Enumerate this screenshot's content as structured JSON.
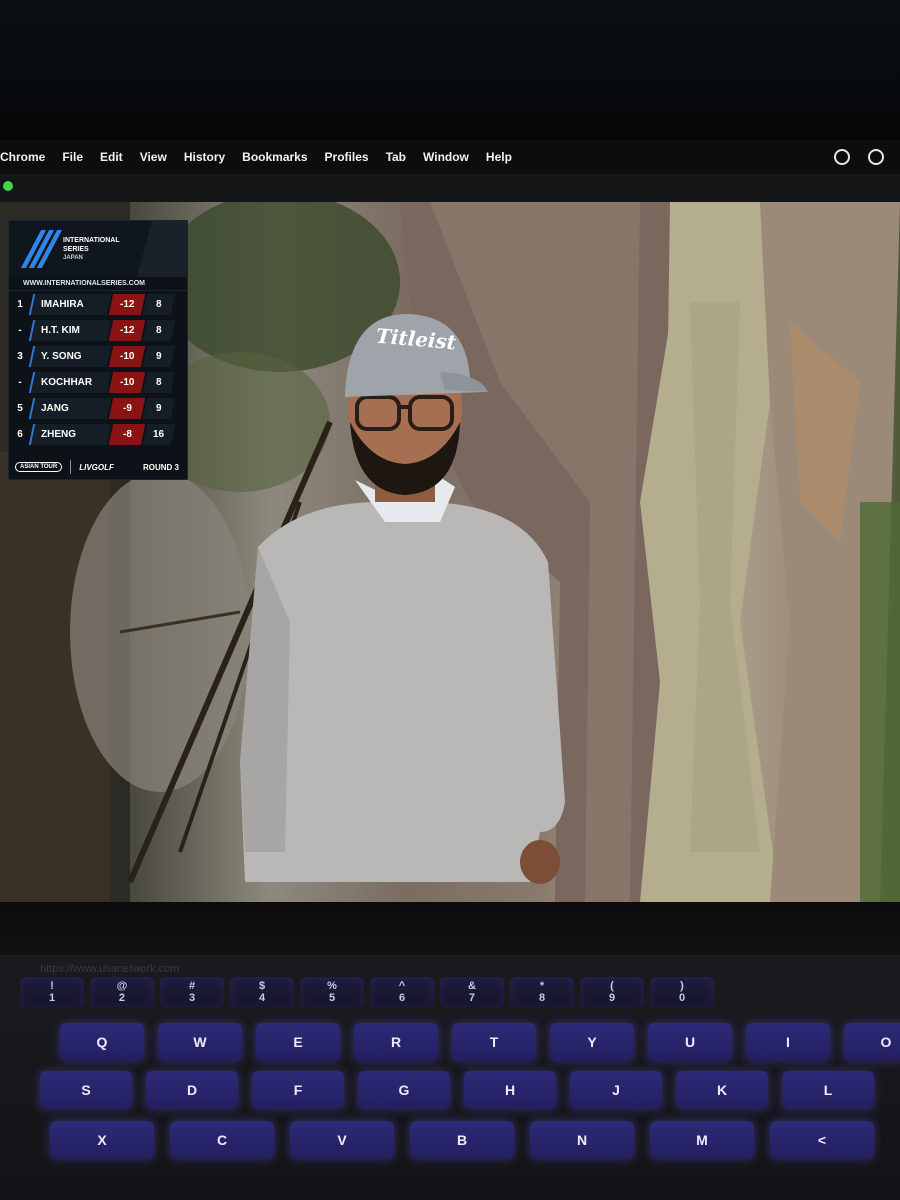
{
  "menubar": {
    "items": [
      "Chrome",
      "File",
      "Edit",
      "View",
      "History",
      "Bookmarks",
      "Profiles",
      "Tab",
      "Window",
      "Help"
    ],
    "icons": [
      "creative-cloud-icon",
      "play-circle-icon"
    ]
  },
  "scoreboard": {
    "brand_line1": "INTERNATIONAL",
    "brand_line2": "SERIES",
    "brand_line3": "JAPAN",
    "url": "WWW.INTERNATIONALSERIES.COM",
    "rows": [
      {
        "pos": "1",
        "name": "IMAHIRA",
        "score": "-12",
        "thru": "8"
      },
      {
        "pos": "-",
        "name": "H.T. KIM",
        "score": "-12",
        "thru": "8"
      },
      {
        "pos": "3",
        "name": "Y. SONG",
        "score": "-10",
        "thru": "9"
      },
      {
        "pos": "-",
        "name": "KOCHHAR",
        "score": "-10",
        "thru": "8"
      },
      {
        "pos": "5",
        "name": "JANG",
        "score": "-9",
        "thru": "9"
      },
      {
        "pos": "6",
        "name": "ZHENG",
        "score": "-8",
        "thru": "16"
      }
    ],
    "footer_left": "ASIAN TOUR",
    "footer_liv": "LIVGOLF",
    "round": "ROUND 3"
  },
  "cap_text": "Titleist",
  "reflection_text": "https://www.usanetwork.com",
  "keyboard": {
    "row1": [
      "!\n1",
      "@\n2",
      "#\n3",
      "$\n4",
      "%\n5",
      "^\n6",
      "&\n7",
      "*\n8",
      "(\n9",
      ")\n0"
    ],
    "row2": [
      "Q",
      "W",
      "E",
      "R",
      "T",
      "Y",
      "U",
      "I",
      "O"
    ],
    "row3": [
      "S",
      "D",
      "F",
      "G",
      "H",
      "J",
      "K",
      "L"
    ],
    "row4": [
      "X",
      "C",
      "V",
      "B",
      "N",
      "M",
      "<"
    ]
  },
  "colors": {
    "score_red": "#8a1313",
    "brand_blue": "#2e86e8",
    "key_glow": "#2d2a78"
  }
}
